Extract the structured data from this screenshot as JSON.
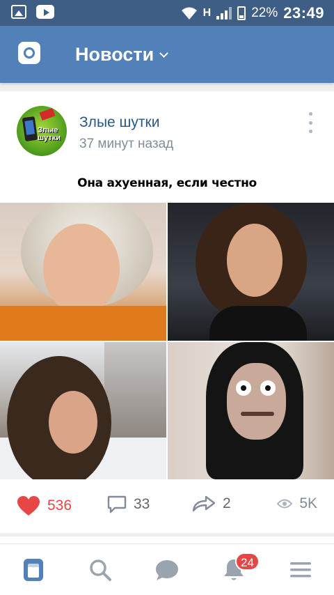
{
  "status_bar": {
    "network_letter": "H",
    "battery": "22%",
    "time": "23:49"
  },
  "header": {
    "title": "Новости"
  },
  "post": {
    "author": "Злые шутки",
    "time": "37 минут назад",
    "caption": "Она ахуенная, если честно",
    "avatar_text": "Злые шутки",
    "likes": "536",
    "comments": "33",
    "shares": "2",
    "views": "5K"
  },
  "bottom_nav": {
    "notifications_badge": "24"
  },
  "colors": {
    "header": "#5181b8",
    "status_bar": "#3f5e86",
    "like_red": "#e64646",
    "link_blue": "#2a5885",
    "muted": "#818c99"
  },
  "icons": [
    "image-icon",
    "youtube-icon",
    "wifi-icon",
    "signal-icon",
    "battery-icon",
    "camera-icon",
    "chevron-down-icon",
    "more-vertical-icon",
    "heart-icon",
    "comment-icon",
    "share-icon",
    "views-icon",
    "feed-icon",
    "search-icon",
    "messages-icon",
    "bell-icon",
    "menu-icon"
  ]
}
